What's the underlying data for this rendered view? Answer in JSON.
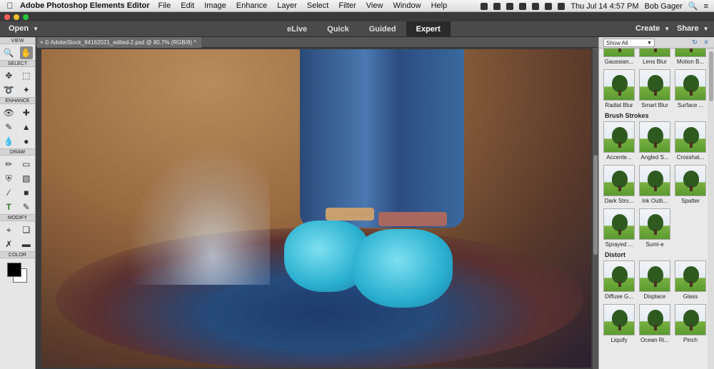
{
  "menubar": {
    "app": "Adobe Photoshop Elements Editor",
    "items": [
      "File",
      "Edit",
      "Image",
      "Enhance",
      "Layer",
      "Select",
      "Filter",
      "View",
      "Window",
      "Help"
    ],
    "datetime": "Thu Jul 14  4:57 PM",
    "user": "Bob Gager"
  },
  "toolbar": {
    "open_label": "Open",
    "modes": [
      "eLive",
      "Quick",
      "Guided",
      "Expert"
    ],
    "active_mode": "Expert",
    "create_label": "Create",
    "share_label": "Share"
  },
  "document": {
    "tab_title": "© AdobeStock_84162021_edited-2.psd @ 80.7% (RGB/8) *"
  },
  "tools": {
    "sections": {
      "view": "VIEW",
      "select": "SELECT",
      "enhance": "ENHANCE",
      "draw": "DRAW",
      "modify": "MODIFY",
      "color": "COLOR"
    }
  },
  "panel": {
    "filter_select": "Show All",
    "top_row": [
      "Gaussian...",
      "Lens Blur",
      "Motion B..."
    ],
    "blur_row": [
      "Radial Blur",
      "Smart Blur",
      "Surface ..."
    ],
    "brush_strokes": {
      "title": "Brush Strokes",
      "items": [
        "Accente...",
        "Angled S...",
        "Crosshat...",
        "Dark Stro...",
        "Ink Outli...",
        "Spatter",
        "Sprayed ...",
        "Sumi-e"
      ]
    },
    "distort": {
      "title": "Distort",
      "items": [
        "Diffuse G...",
        "Displace",
        "Glass",
        "Liquify",
        "Ocean Ri...",
        "Pinch"
      ]
    }
  },
  "colors": {
    "accent": "#2a2a2a",
    "foreground": "#000000",
    "background": "#ffffff"
  }
}
